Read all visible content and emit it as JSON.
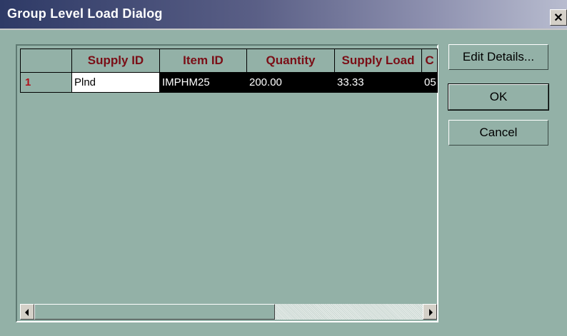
{
  "window": {
    "title": "Group Level Load Dialog",
    "close_glyph": "✕"
  },
  "grid": {
    "columns": [
      "",
      "Supply ID",
      "Item ID",
      "Quantity",
      "Supply Load",
      "C"
    ],
    "rows": [
      {
        "row_number": "1",
        "supply_id": "Plnd",
        "item_id": "IMPHM25",
        "quantity": "200.00",
        "supply_load": "33.33",
        "c": "05"
      }
    ],
    "horizontal_scroll_fraction": 0.62
  },
  "buttons": {
    "edit_details": "Edit Details...",
    "ok": "OK",
    "cancel": "Cancel"
  },
  "colors": {
    "face": "#93b1a7",
    "header_text": "#7a0e16",
    "row_number_text": "#b0101a",
    "selection": "#000000"
  }
}
